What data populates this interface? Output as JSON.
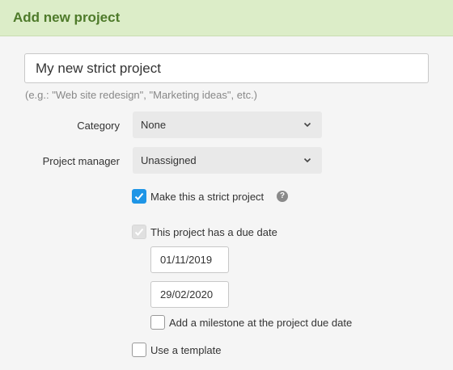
{
  "header": {
    "title": "Add new project"
  },
  "project_name": {
    "value": "My new strict project"
  },
  "hint": "(e.g.: \"Web site redesign\", \"Marketing ideas\", etc.)",
  "category": {
    "label": "Category",
    "selected": "None"
  },
  "project_manager": {
    "label": "Project manager",
    "selected": "Unassigned"
  },
  "strict_project": {
    "label": "Make this a strict project",
    "checked": true,
    "help_icon": "question-circle-icon"
  },
  "due_date": {
    "label": "This project has a due date",
    "checked": true,
    "disabled": true,
    "start_date": "01/11/2019",
    "end_date": "29/02/2020"
  },
  "milestone": {
    "label": "Add a milestone at the project due date",
    "checked": false
  },
  "template": {
    "label": "Use a template",
    "checked": false
  },
  "colors": {
    "header_bg": "#dcedc8",
    "header_text": "#4e7a2a",
    "checkbox_accent": "#1e95e6"
  }
}
